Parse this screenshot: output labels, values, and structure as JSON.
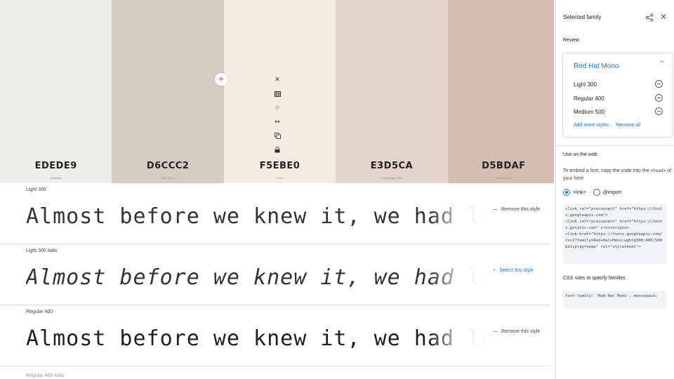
{
  "palette": {
    "swatches": [
      {
        "hex": "EDEDE9",
        "name": "Isabelline",
        "color": "#EDEDE9"
      },
      {
        "hex": "D6CCC2",
        "name": "Pale Silver",
        "color": "#D6CCC2"
      },
      {
        "hex": "F5EBE0",
        "name": "Linen",
        "color": "#F5EBE0"
      },
      {
        "hex": "E3D5CA",
        "name": "Champagne Pink",
        "color": "#E3D5CA"
      },
      {
        "hex": "D5BDAF",
        "name": "Desert Sand",
        "color": "#D5BDAF"
      }
    ],
    "add_label": "+",
    "tools": [
      "close-icon",
      "grid-icon",
      "star-icon",
      "swap-icon",
      "copy-icon",
      "lock-icon"
    ]
  },
  "specimens": {
    "sample_text": "Almost before we knew it, we had left the ground.",
    "rows": [
      {
        "label": "Light 300",
        "action": "Remove this style",
        "action_symbol": "—"
      },
      {
        "label": "Light 300 Italic",
        "action": "Select this style",
        "action_symbol": "+"
      },
      {
        "label": "Regular 400",
        "action": "Remove this style",
        "action_symbol": "—"
      },
      {
        "label": "Regular 400 Italic"
      }
    ]
  },
  "panel": {
    "title": "Selected family",
    "review_label": "Review",
    "family": {
      "name": "Red Hat Mono",
      "styles": [
        "Light 300",
        "Regular 400",
        "Medium 500"
      ],
      "add_more": "Add more styles",
      "remove_all": "Remove all"
    },
    "web": {
      "label": "Use on the web",
      "desc_before": "To embed a font, copy the code into the ",
      "desc_code": "<head>",
      "desc_after": " of your html",
      "option_link": "<link>",
      "option_import": "@import",
      "code": "<link rel=\"preconnect\" href=\"https://fonts.googleapis.com\">\n<link rel=\"preconnect\" href=\"https://fonts.gstatic.com\" crossorigin>\n<link href=\"https://fonts.googleapis.com/css2?family=Red+Hat+Mono:wght@300;400;500&display=swap\" rel=\"stylesheet\">"
    },
    "css": {
      "label": "CSS rules to specify families",
      "code": "font-family: 'Red Hat Mono', monospace;"
    }
  },
  "colors": {
    "accent": "#1a73e8"
  }
}
